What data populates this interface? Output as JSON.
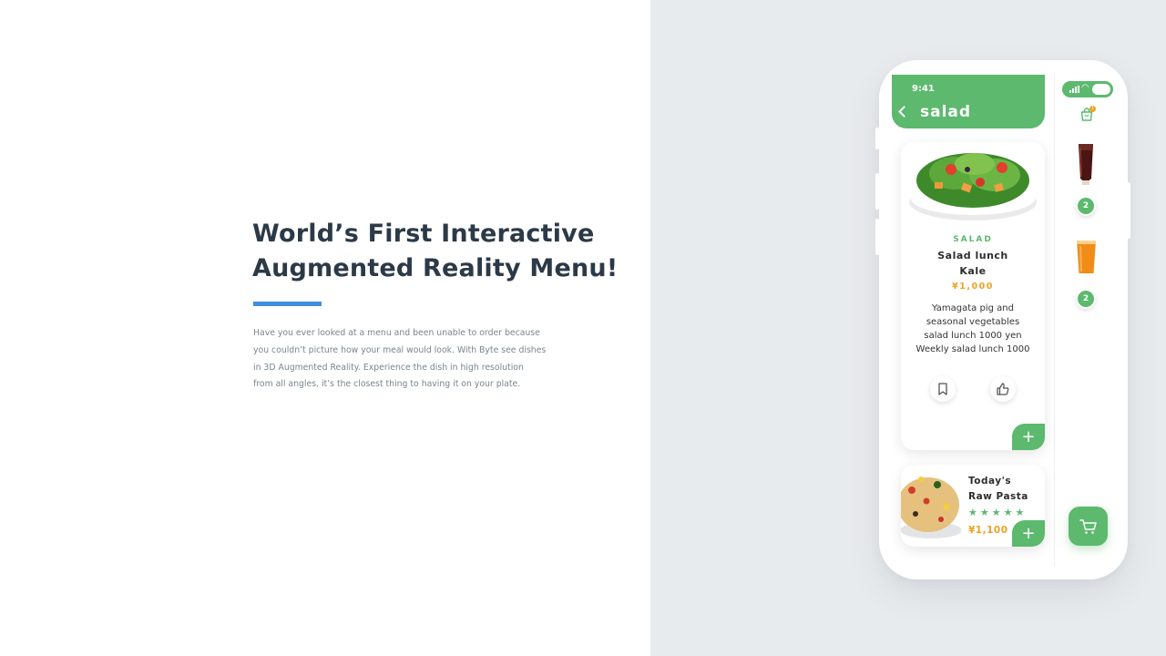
{
  "hero": {
    "headline_line1": "World’s First Interactive",
    "headline_line2": "Augmented Reality Menu!",
    "accent_color": "#3f8fe0",
    "body_lines": [
      "Have you ever looked at a menu and been unable to order because",
      "you couldn’t picture how your meal would look.  With Byte see dishes",
      "in 3D Augmented Reality.  Experience the dish in high resolution",
      "from all angles, it’s the closest thing to having it on your plate."
    ]
  },
  "phone": {
    "status": {
      "time": "9:41"
    },
    "header": {
      "title": "salad",
      "back_icon": "chevron-left-icon"
    },
    "brand_color": "#5cb96e",
    "price_color": "#f0a020",
    "sidebar": {
      "bag_icon": "shopping-bag-icon",
      "bag_badge": "1",
      "items": [
        {
          "name": "cola-glass",
          "quantity": "2"
        },
        {
          "name": "beer-glass",
          "quantity": "2"
        }
      ],
      "cart_icon": "cart-icon"
    },
    "featured": {
      "category": "SALAD",
      "name_line1": "Salad lunch",
      "name_line2": "Kale",
      "price": "¥1,000",
      "description": [
        "Yamagata pig and",
        "seasonal vegetables",
        "salad lunch 1000 yen",
        "Weekly salad lunch 1000"
      ],
      "bookmark_icon": "bookmark-icon",
      "like_icon": "thumbs-up-icon",
      "add_label": "+"
    },
    "second": {
      "name_line1": "Today's",
      "name_line2": "Raw Pasta",
      "rating": 5,
      "price": "¥1,100",
      "add_label": "+"
    }
  }
}
